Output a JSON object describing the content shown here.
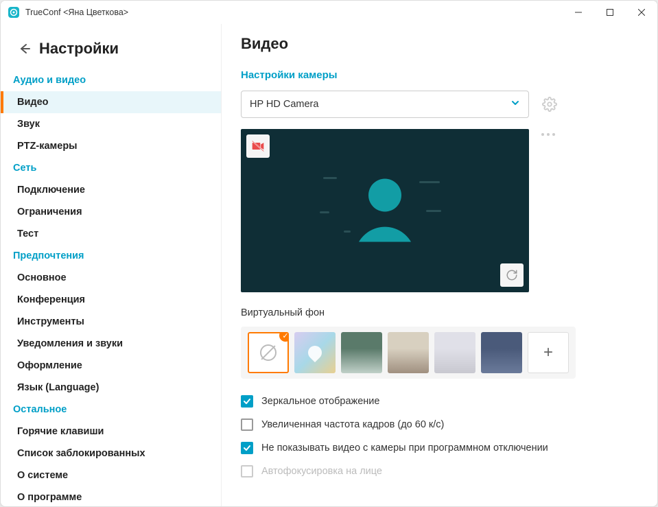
{
  "window": {
    "title": "TrueConf <Яна Цветкова>"
  },
  "sidebar": {
    "title": "Настройки",
    "groups": [
      {
        "label": "Аудио и видео",
        "items": [
          "Видео",
          "Звук",
          "PTZ-камеры"
        ]
      },
      {
        "label": "Сеть",
        "items": [
          "Подключение",
          "Ограничения",
          "Тест"
        ]
      },
      {
        "label": "Предпочтения",
        "items": [
          "Основное",
          "Конференция",
          "Инструменты",
          "Уведомления и звуки",
          "Оформление",
          "Язык (Language)"
        ]
      },
      {
        "label": "Остальное",
        "items": [
          "Горячие клавиши",
          "Список заблокированных",
          "О системе",
          "О программе"
        ]
      }
    ],
    "active": "Видео"
  },
  "main": {
    "title": "Видео",
    "camera_section": "Настройки камеры",
    "camera_selected": "HP HD Camera",
    "virtual_bg_label": "Виртуальный фон",
    "checks": [
      {
        "label": "Зеркальное отображение",
        "checked": true,
        "disabled": false
      },
      {
        "label": "Увеличенная частота кадров (до 60 к/с)",
        "checked": false,
        "disabled": false
      },
      {
        "label": "Не показывать видео с камеры при программном отключении",
        "checked": true,
        "disabled": false
      },
      {
        "label": "Автофокусировка на лице",
        "checked": false,
        "disabled": true
      }
    ]
  }
}
